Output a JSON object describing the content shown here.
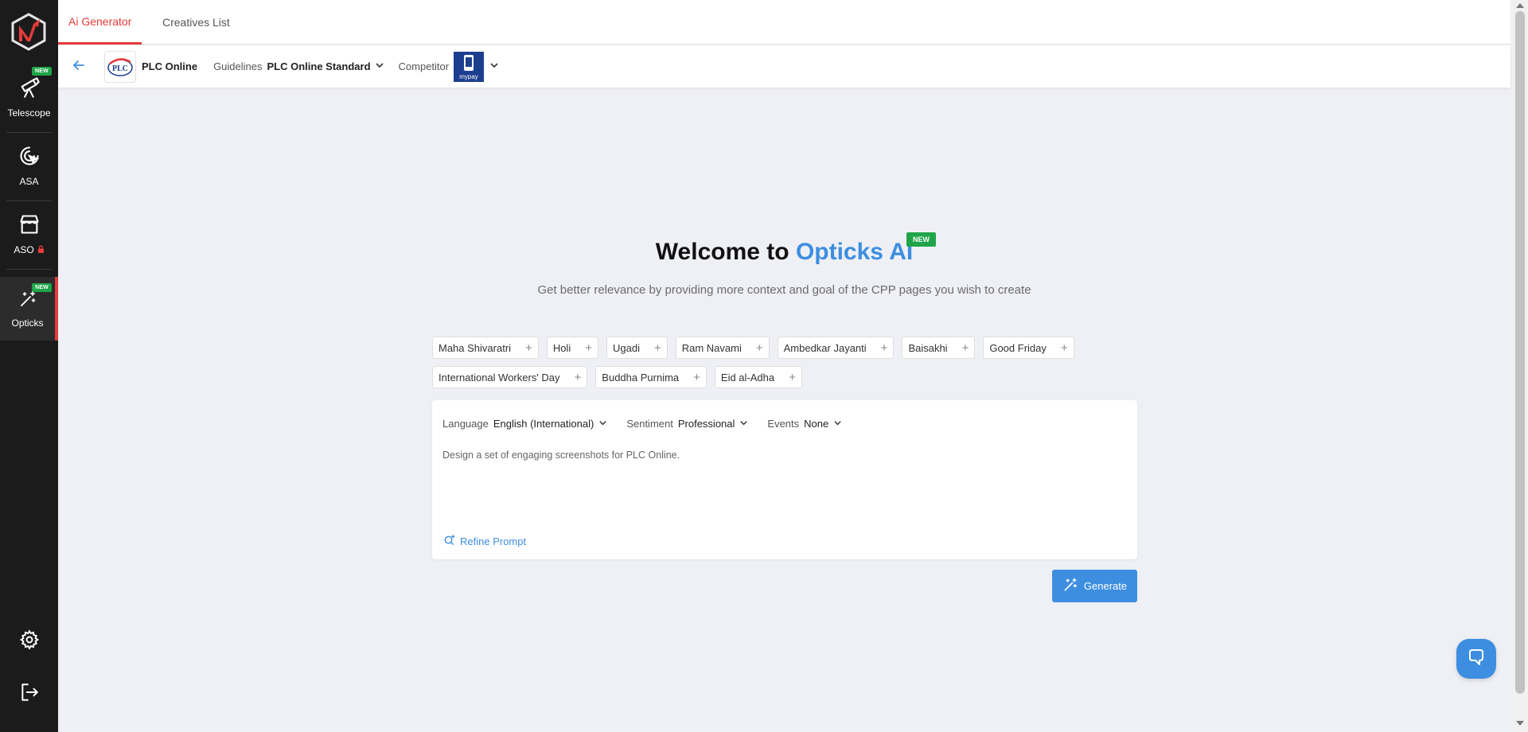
{
  "sidebar": {
    "items": [
      {
        "label": "Telescope",
        "badge": "NEW"
      },
      {
        "label": "ASA"
      },
      {
        "label": "ASO"
      },
      {
        "label": "Opticks",
        "badge": "NEW"
      }
    ]
  },
  "tabs": [
    {
      "label": "Ai Generator",
      "active": true
    },
    {
      "label": "Creatives List",
      "active": false
    }
  ],
  "appbar": {
    "app_logo_text": "PLC",
    "app_name": "PLC Online",
    "guidelines_label": "Guidelines",
    "guidelines_value": "PLC Online Standard",
    "competitor_label": "Competitor",
    "competitor_logo_text": "mypay"
  },
  "hero": {
    "title_prefix": "Welcome to ",
    "title_accent": "Opticks AI",
    "badge": "NEW",
    "subtitle": "Get better relevance by providing more context and goal of the CPP pages you wish to create"
  },
  "events": [
    "Maha Shivaratri",
    "Holi",
    "Ugadi",
    "Ram Navami",
    "Ambedkar Jayanti",
    "Baisakhi",
    "Good Friday",
    "International Workers' Day",
    "Buddha Purnima",
    "Eid al-Adha"
  ],
  "prompt": {
    "language_label": "Language",
    "language_value": "English (International)",
    "sentiment_label": "Sentiment",
    "sentiment_value": "Professional",
    "events_label": "Events",
    "events_value": "None",
    "text": "Design a set of engaging screenshots for PLC Online.",
    "refine_label": "Refine Prompt"
  },
  "generate_label": "Generate",
  "colors": {
    "accent": "#3d8ee0",
    "brand_red": "#e53b3b",
    "badge_green": "#1fa548",
    "sidebar": "#1b1b1b"
  }
}
